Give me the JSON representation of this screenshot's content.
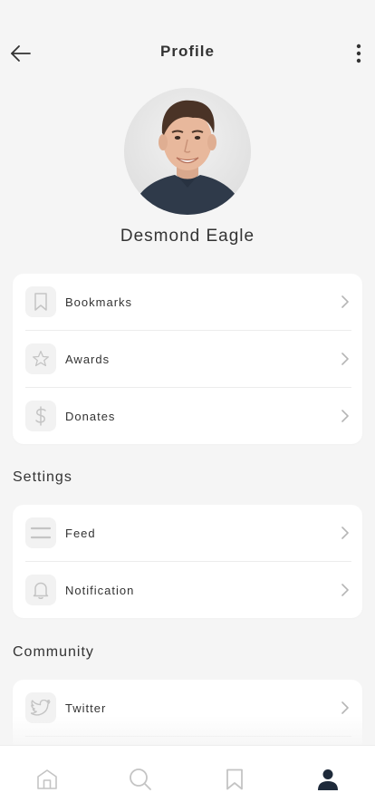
{
  "header": {
    "title": "Profile",
    "back_icon": "arrow-left-icon",
    "more_icon": "more-vertical-icon"
  },
  "user": {
    "name": "Desmond Eagle",
    "avatar": "avatar-photo"
  },
  "account_items": [
    {
      "label": "Bookmarks",
      "icon": "bookmark-icon"
    },
    {
      "label": "Awards",
      "icon": "star-icon"
    },
    {
      "label": "Donates",
      "icon": "dollar-icon"
    }
  ],
  "settings": {
    "title": "Settings",
    "items": [
      {
        "label": "Feed",
        "icon": "feed-icon"
      },
      {
        "label": "Notification",
        "icon": "bell-icon"
      }
    ]
  },
  "community": {
    "title": "Community",
    "items": [
      {
        "label": "Twitter",
        "icon": "twitter-icon"
      }
    ]
  },
  "tabbar": {
    "tabs": [
      {
        "icon": "home-icon",
        "active": false
      },
      {
        "icon": "search-icon",
        "active": false
      },
      {
        "icon": "bookmark-icon",
        "active": false
      },
      {
        "icon": "profile-icon",
        "active": true
      }
    ]
  },
  "colors": {
    "background": "#f5f5f5",
    "card": "#ffffff",
    "text": "#333333",
    "icon_muted": "#c4c4c4",
    "active_tab": "#1e2a3a"
  }
}
